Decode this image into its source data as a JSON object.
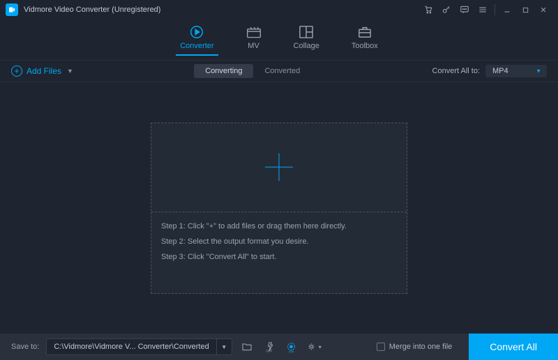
{
  "titlebar": {
    "app_title": "Vidmore Video Converter (Unregistered)"
  },
  "tabs": {
    "converter": "Converter",
    "mv": "MV",
    "collage": "Collage",
    "toolbox": "Toolbox"
  },
  "toolbar": {
    "add_files": "Add Files",
    "converting": "Converting",
    "converted": "Converted",
    "convert_all_to_label": "Convert All to:",
    "format_selected": "MP4"
  },
  "dropzone": {
    "step1": "Step 1: Click \"+\" to add files or drag them here directly.",
    "step2": "Step 2: Select the output format you desire.",
    "step3": "Step 3: Click \"Convert All\" to start."
  },
  "footer": {
    "save_to_label": "Save to:",
    "save_path": "C:\\Vidmore\\Vidmore V... Converter\\Converted",
    "merge_label": "Merge into one file",
    "convert_all_btn": "Convert All"
  },
  "colors": {
    "accent": "#00a7f5",
    "bg": "#1e2530"
  }
}
